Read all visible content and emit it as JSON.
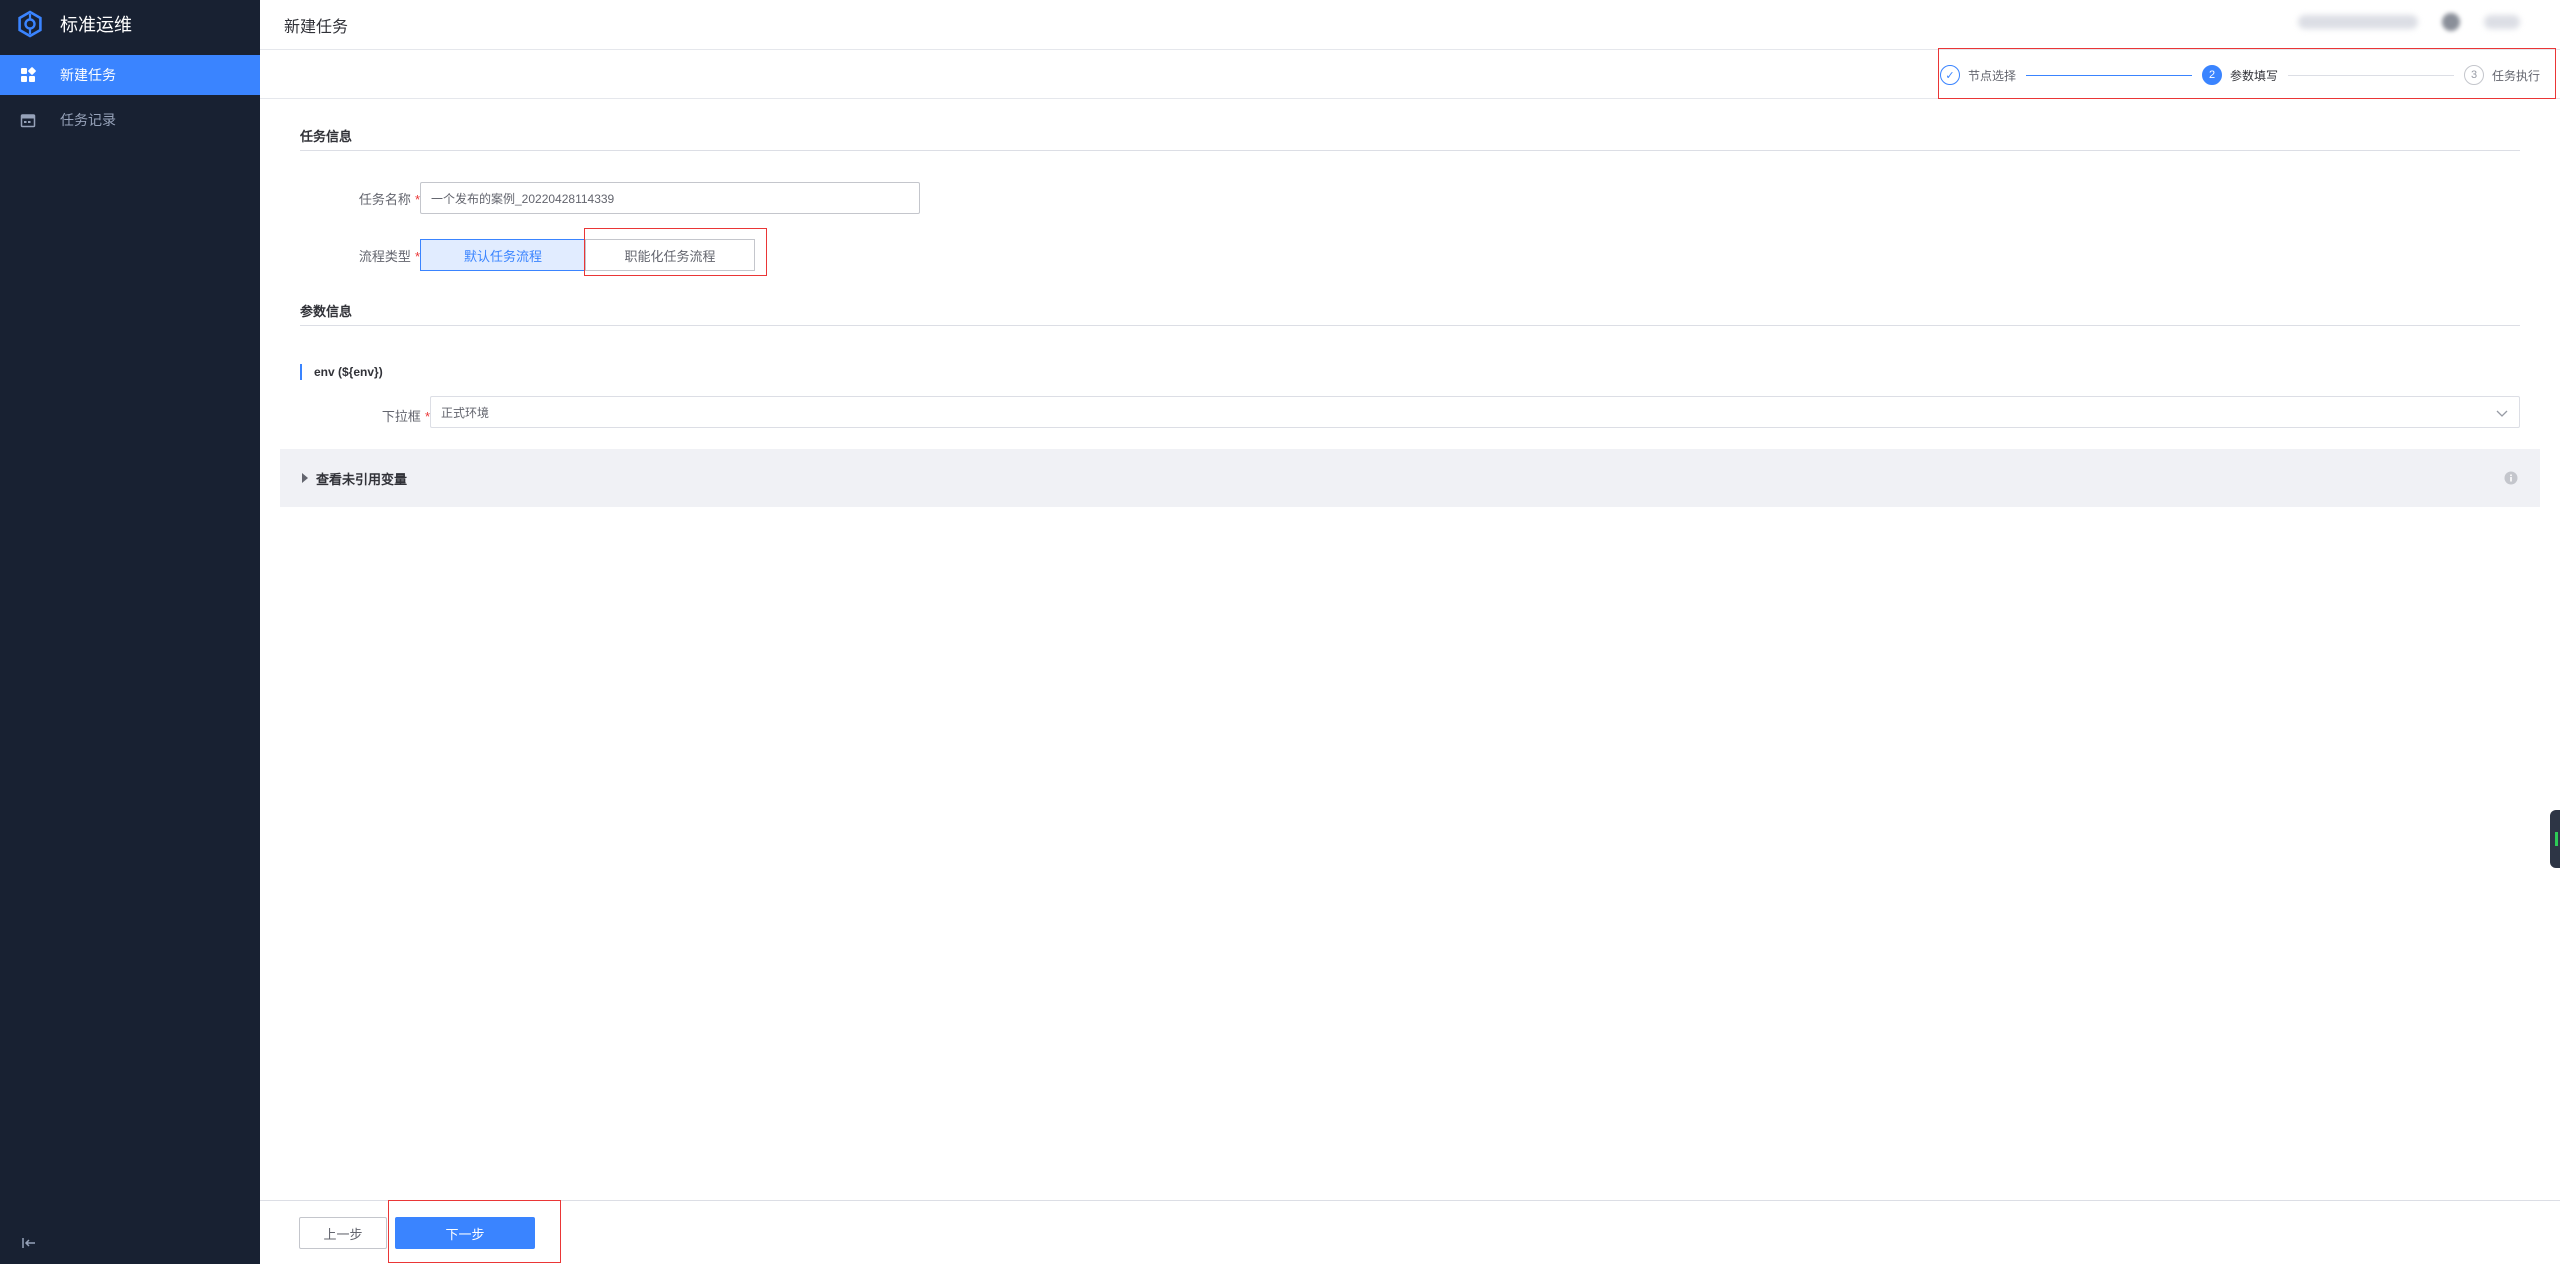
{
  "app": {
    "title": "标准运维"
  },
  "sidebar": {
    "items": [
      {
        "label": "新建任务",
        "icon": "grid-icon",
        "active": true
      },
      {
        "label": "任务记录",
        "icon": "calendar-icon",
        "active": false
      }
    ],
    "collapse_icon": "collapse-left-icon"
  },
  "header": {
    "title": "新建任务"
  },
  "steps": [
    {
      "index": "✓",
      "label": "节点选择",
      "state": "done"
    },
    {
      "index": "2",
      "label": "参数填写",
      "state": "current"
    },
    {
      "index": "3",
      "label": "任务执行",
      "state": "pending"
    }
  ],
  "task_info": {
    "section_title": "任务信息",
    "name_label": "任务名称",
    "name_value": "一个发布的案例_20220428114339",
    "flow_type_label": "流程类型",
    "flow_type_options": [
      {
        "label": "默认任务流程",
        "selected": true
      },
      {
        "label": "职能化任务流程",
        "selected": false
      }
    ]
  },
  "params": {
    "section_title": "参数信息",
    "var_title": "env (${env})",
    "select_label": "下拉框",
    "select_value": "正式环境",
    "unreferenced_label": "查看未引用变量"
  },
  "footer": {
    "prev_label": "上一步",
    "next_label": "下一步"
  },
  "colors": {
    "sidebar_bg": "#182132",
    "primary": "#3a84ff",
    "required": "#ea3636",
    "annotation": "#ea3636"
  }
}
